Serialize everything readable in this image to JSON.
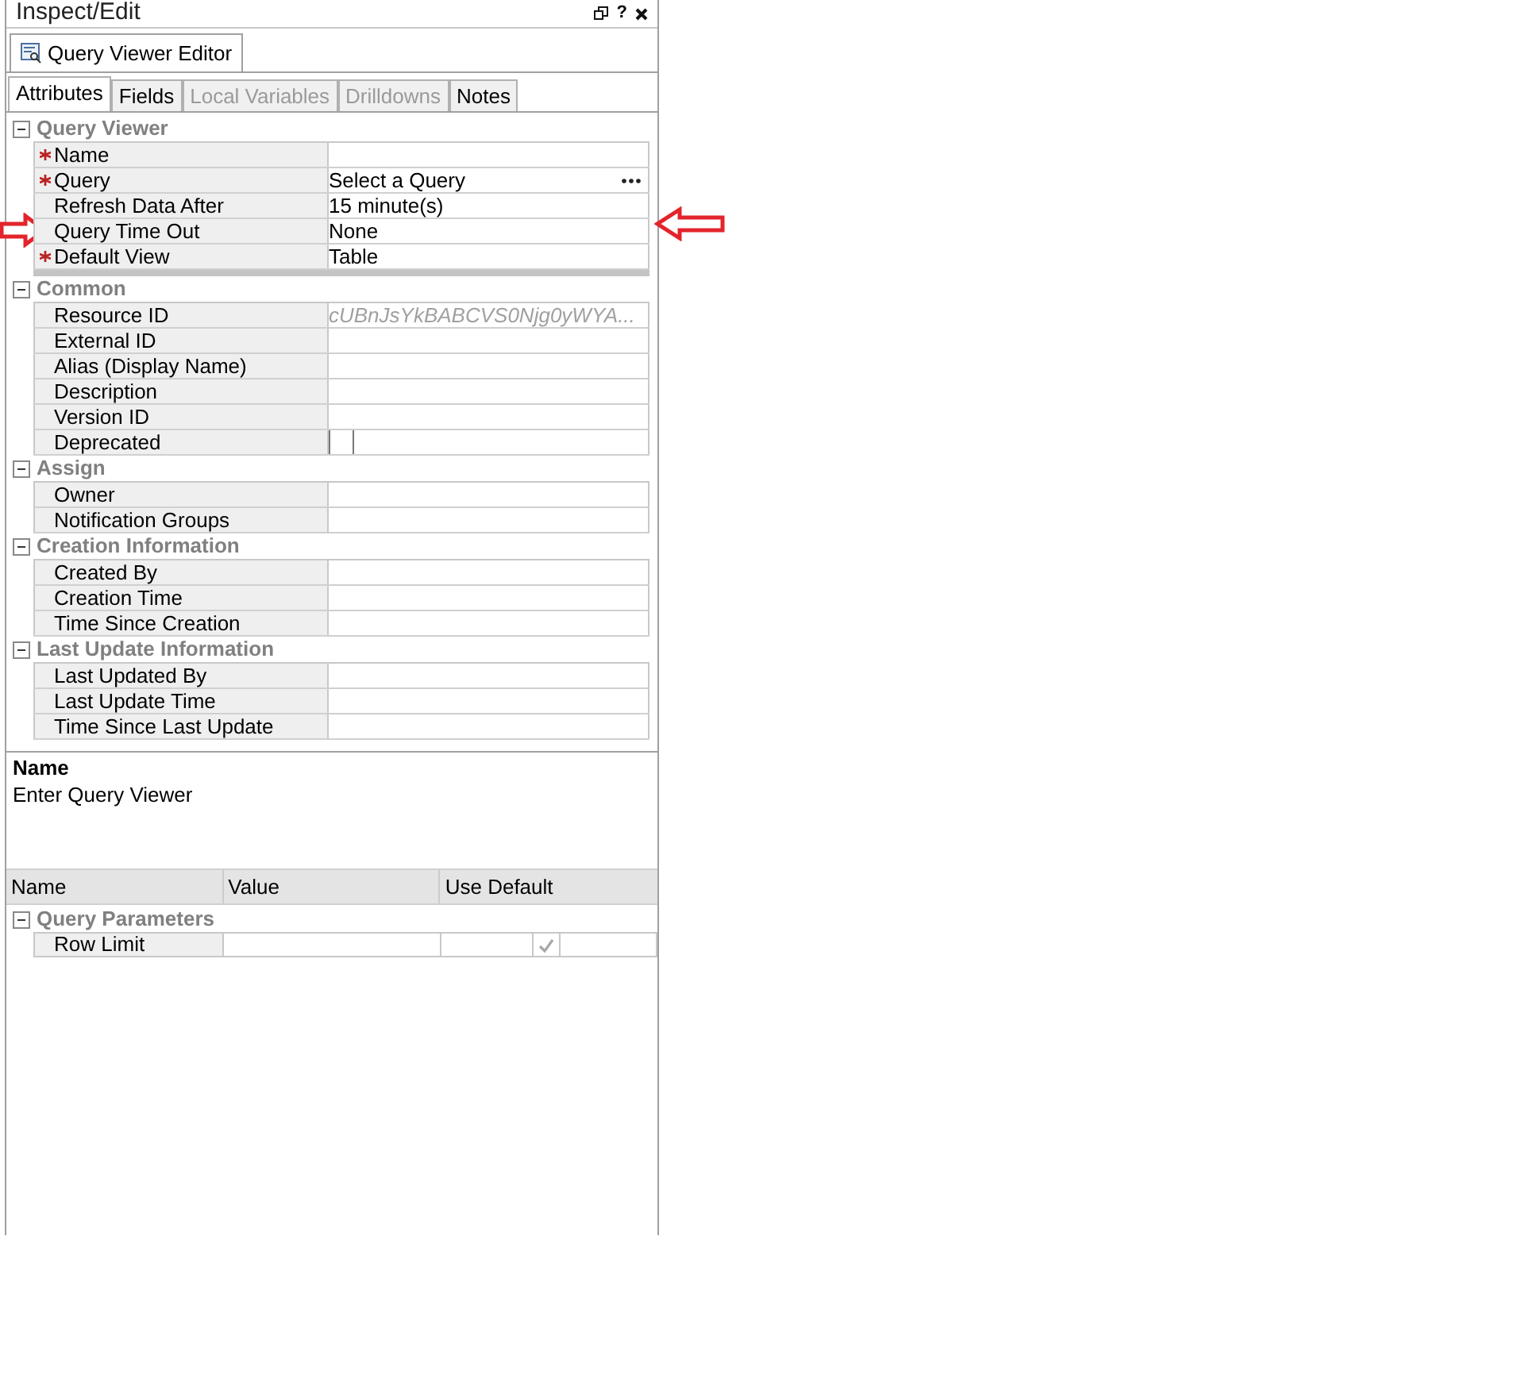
{
  "panel": {
    "title": "Inspect/Edit",
    "help": "?"
  },
  "editor_tab": {
    "label": "Query Viewer Editor",
    "selected": true
  },
  "tabs": [
    {
      "label": "Attributes",
      "selected": true,
      "disabled": false
    },
    {
      "label": "Fields",
      "selected": false,
      "disabled": false
    },
    {
      "label": "Local Variables",
      "selected": false,
      "disabled": true
    },
    {
      "label": "Drilldowns",
      "selected": false,
      "disabled": true
    },
    {
      "label": "Notes",
      "selected": false,
      "disabled": false
    }
  ],
  "sections": [
    {
      "name": "Query Viewer",
      "expanded": true,
      "rows": [
        {
          "label": "Name",
          "required": true,
          "value": "",
          "kind": "text",
          "annotated": false
        },
        {
          "label": "Query",
          "required": true,
          "value": "Select a Query",
          "kind": "picker",
          "annotated": false
        },
        {
          "label": "Refresh Data After",
          "required": false,
          "value": "15 minute(s)",
          "kind": "text",
          "annotated": false
        },
        {
          "label": "Query Time Out",
          "required": false,
          "value": "None",
          "kind": "text",
          "annotated": true
        },
        {
          "label": "Default View",
          "required": true,
          "value": "Table",
          "kind": "text",
          "annotated": false
        }
      ]
    },
    {
      "name": "Common",
      "expanded": true,
      "rows": [
        {
          "label": "Resource ID",
          "required": false,
          "value": "cUBnJsYkBABCVS0Njg0yWYA...",
          "kind": "readonly",
          "annotated": false
        },
        {
          "label": "External ID",
          "required": false,
          "value": "",
          "kind": "text",
          "annotated": false
        },
        {
          "label": "Alias (Display Name)",
          "required": false,
          "value": "",
          "kind": "text",
          "annotated": false
        },
        {
          "label": "Description",
          "required": false,
          "value": "",
          "kind": "text",
          "annotated": false
        },
        {
          "label": "Version ID",
          "required": false,
          "value": "",
          "kind": "text",
          "annotated": false
        },
        {
          "label": "Deprecated",
          "required": false,
          "checked": false,
          "kind": "checkbox",
          "annotated": false
        }
      ]
    },
    {
      "name": "Assign",
      "expanded": true,
      "rows": [
        {
          "label": "Owner",
          "required": false,
          "value": "",
          "kind": "text",
          "annotated": false
        },
        {
          "label": "Notification Groups",
          "required": false,
          "value": "",
          "kind": "text",
          "annotated": false
        }
      ]
    },
    {
      "name": "Creation Information",
      "expanded": true,
      "rows": [
        {
          "label": "Created By",
          "required": false,
          "value": "",
          "kind": "text",
          "annotated": false
        },
        {
          "label": "Creation Time",
          "required": false,
          "value": "",
          "kind": "text",
          "annotated": false
        },
        {
          "label": "Time Since Creation",
          "required": false,
          "value": "",
          "kind": "text",
          "annotated": false
        }
      ]
    },
    {
      "name": "Last Update Information",
      "expanded": true,
      "rows": [
        {
          "label": "Last Updated By",
          "required": false,
          "value": "",
          "kind": "text",
          "annotated": false
        },
        {
          "label": "Last Update Time",
          "required": false,
          "value": "",
          "kind": "text",
          "annotated": false
        },
        {
          "label": "Time Since Last Update",
          "required": false,
          "value": "",
          "kind": "text",
          "annotated": false
        }
      ]
    }
  ],
  "description": {
    "title": "Name",
    "text": "Enter Query Viewer"
  },
  "parameters": {
    "columns": [
      "Name",
      "Value",
      "Use Default"
    ],
    "section": {
      "name": "Query Parameters",
      "expanded": true
    },
    "rows": [
      {
        "name": "Row Limit",
        "value": "",
        "use_default": true
      }
    ]
  }
}
